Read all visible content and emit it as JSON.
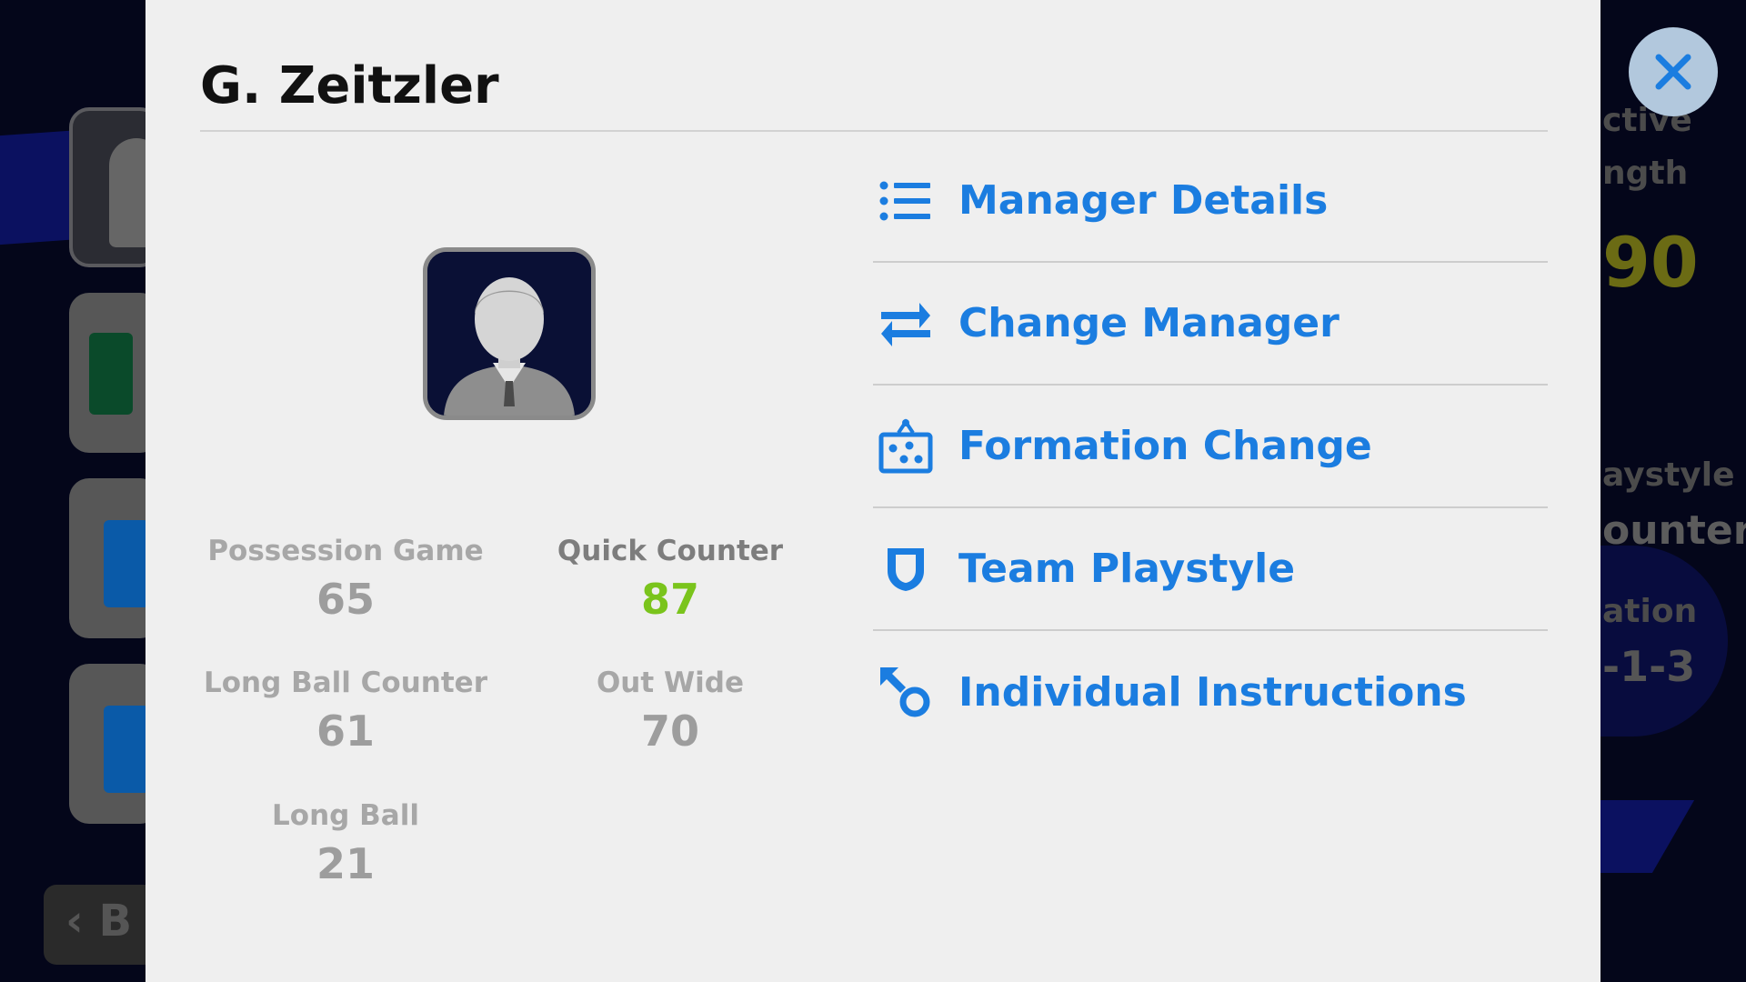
{
  "background": {
    "back_label": "B",
    "right_panel": {
      "line1": "ctive",
      "line2": "ngth",
      "value": "90",
      "line4": "aystyle",
      "line5": "ounter",
      "line6": "ation",
      "line7": "-1-3"
    }
  },
  "modal": {
    "title": "G. Zeitzler",
    "close_icon": "close-icon",
    "stats": [
      {
        "label": "Possession Game",
        "value": "65",
        "active": false
      },
      {
        "label": "Quick Counter",
        "value": "87",
        "active": true
      },
      {
        "label": "Long Ball Counter",
        "value": "61",
        "active": false
      },
      {
        "label": "Out Wide",
        "value": "70",
        "active": false
      },
      {
        "label": "Long Ball",
        "value": "21",
        "active": false
      }
    ],
    "menu": [
      {
        "label": "Manager Details",
        "icon": "list-icon"
      },
      {
        "label": "Change Manager",
        "icon": "swap-arrows-icon"
      },
      {
        "label": "Formation Change",
        "icon": "formation-board-icon"
      },
      {
        "label": "Team Playstyle",
        "icon": "shield-icon"
      },
      {
        "label": "Individual Instructions",
        "icon": "instruction-arrow-icon"
      }
    ]
  },
  "colors": {
    "accent": "#1b7de0",
    "active_value": "#7ac41c",
    "modal_bg": "#efefef",
    "close_bg": "#b2c8dd"
  }
}
